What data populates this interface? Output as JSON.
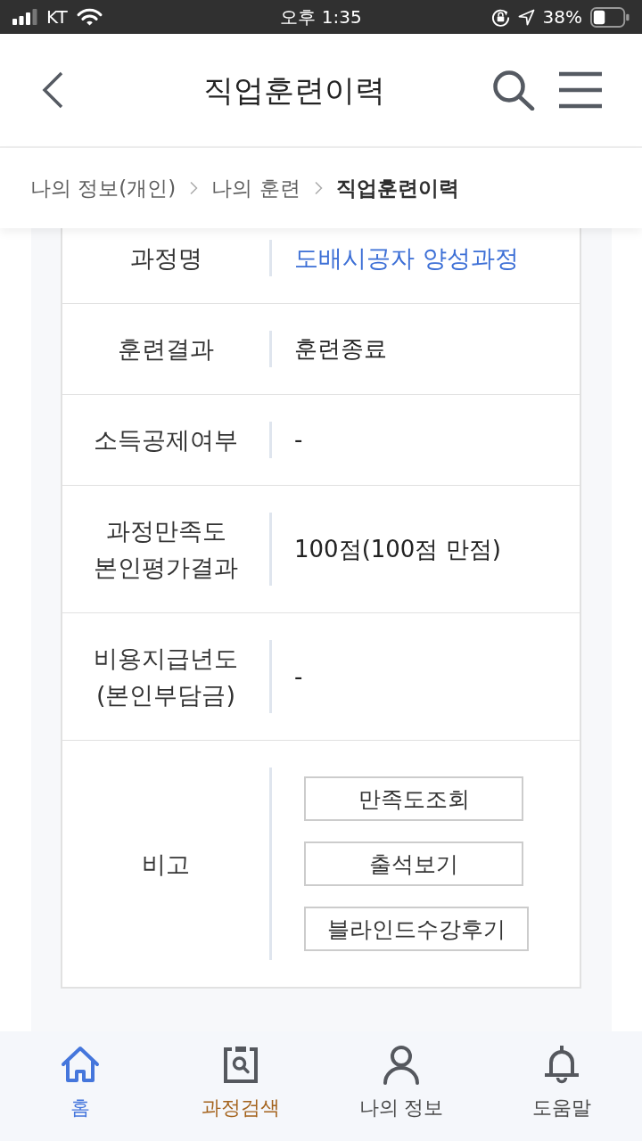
{
  "status_bar": {
    "carrier": "KT",
    "time": "오후 1:35",
    "battery": "38%"
  },
  "header": {
    "title": "직업훈련이력"
  },
  "breadcrumb": [
    {
      "label": "나의 정보(개인)",
      "current": false
    },
    {
      "label": "나의 훈련",
      "current": false
    },
    {
      "label": "직업훈련이력",
      "current": true
    }
  ],
  "details": [
    {
      "label": "과정명",
      "kind": "link",
      "value": "도배시공자 양성과정"
    },
    {
      "label": "훈련결과",
      "kind": "text",
      "value": "훈련종료"
    },
    {
      "label": "소득공제여부",
      "kind": "text",
      "value": "-"
    },
    {
      "label": "과정만족도\n본인평가결과",
      "kind": "text",
      "value": "100점(100점 만점)"
    },
    {
      "label": "비용지급년도\n(본인부담금)",
      "kind": "text",
      "value": "-"
    },
    {
      "label": "비고",
      "kind": "buttons",
      "buttons": [
        "만족도조회",
        "출석보기",
        "블라인드수강후기"
      ]
    }
  ],
  "nav": [
    {
      "label": "홈",
      "selected": true,
      "color": "#4576dc"
    },
    {
      "label": "과정검색",
      "selected": false,
      "color": "#a4631d"
    },
    {
      "label": "나의 정보",
      "selected": false,
      "color": "#4a4a4a"
    },
    {
      "label": "도움말",
      "selected": false,
      "color": "#4a4a4a"
    }
  ]
}
